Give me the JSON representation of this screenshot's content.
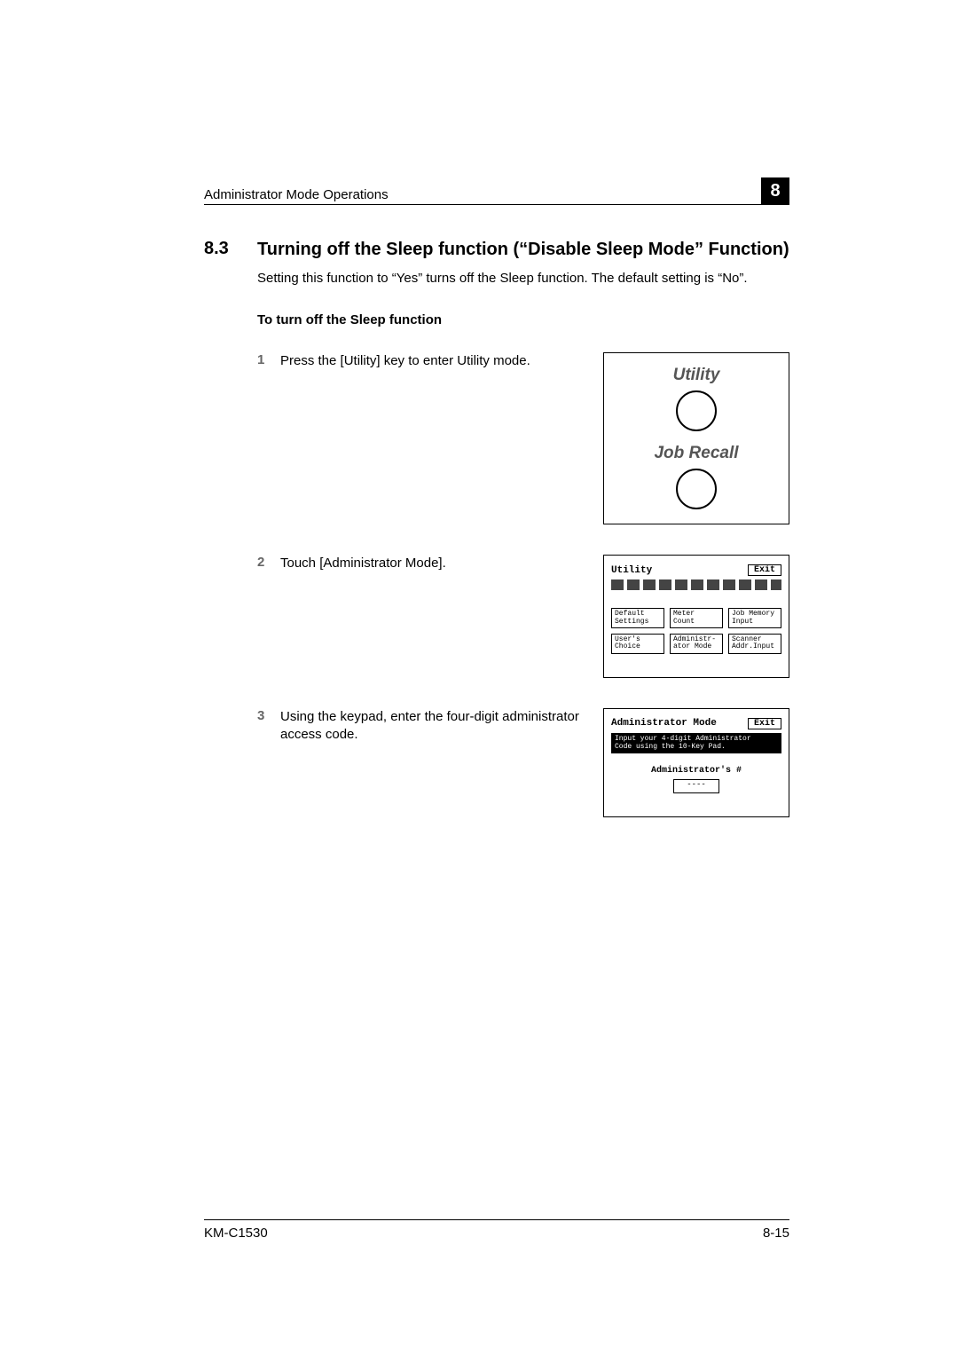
{
  "header": {
    "title": "Administrator Mode Operations",
    "chapter": "8"
  },
  "section": {
    "number": "8.3",
    "title": "Turning off the Sleep function (“Disable Sleep Mode” Function)",
    "intro": "Setting this function to “Yes” turns off the Sleep function. The default setting is “No”.",
    "subhead": "To turn off the Sleep function"
  },
  "steps": [
    {
      "num": "1",
      "text": "Press the [Utility] key to enter Utility mode."
    },
    {
      "num": "2",
      "text": "Touch [Administrator Mode]."
    },
    {
      "num": "3",
      "text": "Using the keypad, enter the four-digit administrator access code."
    }
  ],
  "fig1": {
    "utility_label": "Utility",
    "jobrecall_label": "Job Recall"
  },
  "fig2": {
    "title": "Utility",
    "exit": "Exit",
    "buttons": [
      "Default\nSettings",
      "Meter\nCount",
      "Job Memory\nInput",
      "User's\nChoice",
      "Administr-\nator Mode",
      "Scanner\nAddr.Input"
    ]
  },
  "fig3": {
    "title": "Administrator Mode",
    "exit": "Exit",
    "msg": "Input your 4-digit Administrator\nCode using the 10-Key Pad.",
    "code_label": "Administrator's #",
    "code_value": "----"
  },
  "footer": {
    "model": "KM-C1530",
    "page": "8-15"
  }
}
